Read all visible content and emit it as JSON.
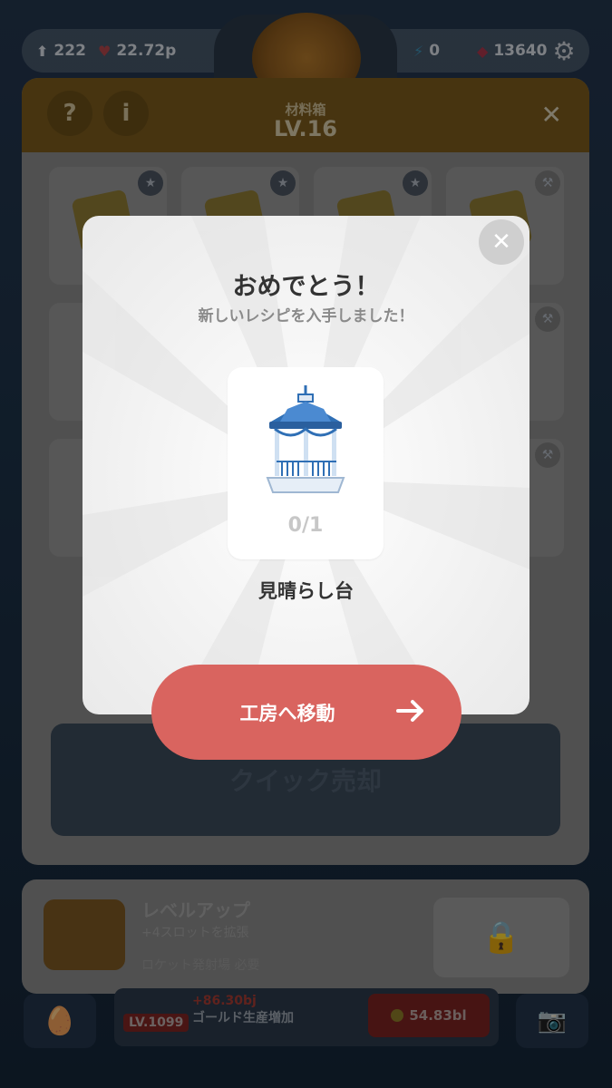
{
  "hud": {
    "stats": [
      {
        "icon": "arrow-up-icon",
        "value": "222"
      },
      {
        "icon": "heart-icon",
        "value": "22.72p"
      },
      {
        "icon": "lightning-icon",
        "value": "0"
      },
      {
        "icon": "gem-icon",
        "value": "13640"
      }
    ],
    "settings_icon": "gear-icon"
  },
  "panel": {
    "title": "材料箱",
    "level": "LV.16",
    "help_label": "?",
    "info_label": "i",
    "close_label": "✕",
    "quick_sell_label": "クイック売却"
  },
  "level_up": {
    "title": "レベルアップ",
    "subtitle": "+4スロットを拡張",
    "requirement": "ロケット発射場 必要"
  },
  "production": {
    "level": "LV.1099",
    "bonus": "+86.30bj",
    "name": "ゴールド生産増加",
    "cost": "54.83bl"
  },
  "modal": {
    "title": "おめでとう！",
    "subtitle": "新しいレシピを入手しました！",
    "recipe_count": "0/1",
    "recipe_name": "見晴らし台",
    "close_label": "✕",
    "action_label": "工房へ移動",
    "colors": {
      "action": "#d9645f",
      "gazebo_roof": "#2f6fb5"
    }
  }
}
